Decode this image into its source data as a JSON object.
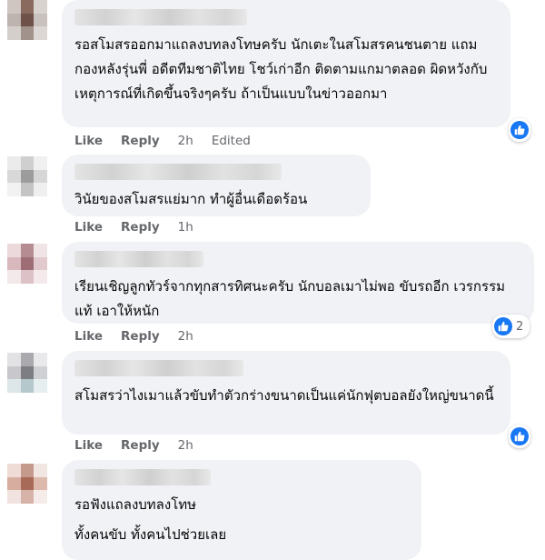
{
  "comments": [
    {
      "paragraphs": [
        "รอสโมสรออกมาแถลงบทลงโทษครับ นักเตะในสโมสรคนชนตาย แถมกองหลังรุ่นพี่ อดีตทีมชาติไทย โชว์เก่าอีก ติดตามแกมาตลอด ผิดหวังกับเหตุการณ์ที่เกิดขึ้นจริงๆครับ ถ้าเป็นแบบในข่าวออกมา"
      ],
      "like": "Like",
      "reply": "Reply",
      "time": "2h",
      "edited": "Edited",
      "reaction_icon": "like-icon",
      "reaction_count": ""
    },
    {
      "paragraphs": [
        "วินัยของสโมสรแย่มาก ทำผู้อื่นเดือดร้อน"
      ],
      "like": "Like",
      "reply": "Reply",
      "time": "1h",
      "reaction_icon": "",
      "reaction_count": ""
    },
    {
      "paragraphs": [
        "เรียนเชิญลูกทัวร์จากทุกสารทิศนะครับ นักบอลเมาไม่พอ ขับรถอีก เวรกรรมแท้ เอาให้หนัก"
      ],
      "like": "Like",
      "reply": "Reply",
      "time": "2h",
      "reaction_icon": "like-icon",
      "reaction_count": "2"
    },
    {
      "paragraphs": [
        "สโมสรว่าไงเมาแล้วขับทำตัวกร่างขนาดเป็นแค่นักฟุตบอลยังใหญ่ขนาดนี้"
      ],
      "like": "Like",
      "reply": "Reply",
      "time": "2h",
      "reaction_icon": "like-icon",
      "reaction_count": ""
    },
    {
      "paragraphs": [
        "รอฟังแถลงบทลงโทษ",
        "ทั้งคนขับ ทั้งคนไปช่วยเลย"
      ],
      "like": "Like",
      "reply": "Reply",
      "time": "",
      "reaction_icon": "",
      "reaction_count": ""
    }
  ],
  "colors": {
    "bubble": "#f0f2f5",
    "meta": "#65676b",
    "like_blue": "#1877f2",
    "text": "#050505"
  }
}
